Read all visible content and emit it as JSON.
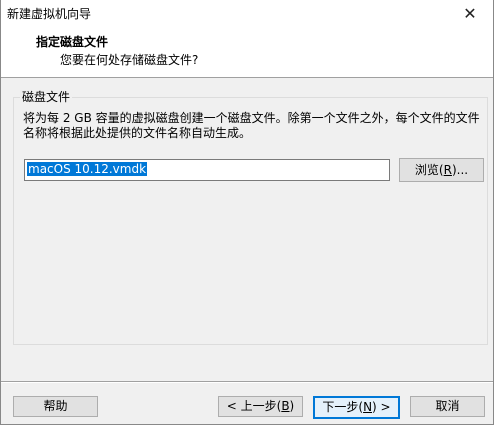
{
  "window": {
    "title": "新建虚拟机向导",
    "close_glyph": "✕"
  },
  "header": {
    "title": "指定磁盘文件",
    "subtitle": "您要在何处存储磁盘文件?"
  },
  "disk_file_group": {
    "label": "磁盘文件",
    "description": "将为每 2 GB 容量的虚拟磁盘创建一个磁盘文件。除第一个文件之外，每个文件的文件名称将根据此处提供的文件名称自动生成。",
    "file_name_value": "macOS 10.12.vmdk",
    "browse_label_pre": "浏览(",
    "browse_mnemonic": "R",
    "browse_label_post": ")..."
  },
  "footer": {
    "help_label": "帮助",
    "back_label_pre": "< 上一步(",
    "back_mnemonic": "B",
    "back_label_post": ")",
    "next_label_pre": "下一步(",
    "next_mnemonic": "N",
    "next_label_post": ") >",
    "cancel_label": "取消"
  }
}
